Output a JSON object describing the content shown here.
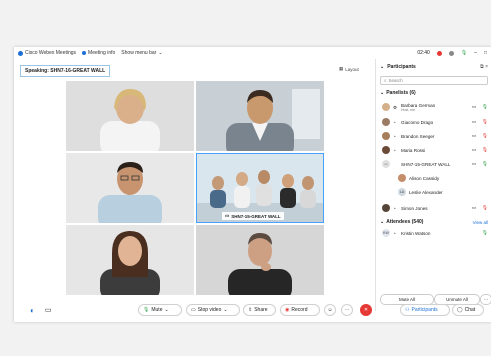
{
  "titlebar": {
    "app": "Cisco Webex Meetings",
    "meeting_info": "Meeting info",
    "menu": "Show menu bar",
    "time": "02:40"
  },
  "speaking": "Speaking: SHN7-16-GREAT WALL",
  "layout_label": "Layout",
  "video_caption": "SHN7-15-GREAT WALL",
  "participants": {
    "title": "Participants",
    "search_placeholder": "Search",
    "panelists_header": "Panelists (6)",
    "panelists": [
      {
        "name": "Barbara German",
        "sub": "Host, me"
      },
      {
        "name": "Giacomo Drago"
      },
      {
        "name": "Brandon Seeger"
      },
      {
        "name": "Maria Rossi"
      },
      {
        "name": "SHN7-15-GREAT WALL"
      },
      {
        "name": "Alison Cassidy"
      },
      {
        "name": "Leslie Alexander"
      },
      {
        "name": "Simon Jones"
      }
    ],
    "attendees_header": "Attendees (540)",
    "view_all": "View all",
    "attendee_initials": "KW",
    "attendee": "Kristin Watson",
    "mute_all": "Mute All",
    "unmute_all": "Unmute All"
  },
  "toolbar": {
    "mute": "Mute",
    "stop_video": "Stop video",
    "share": "Share",
    "record": "Record",
    "participants": "Participants",
    "chat": "Chat"
  },
  "colors": {
    "accent": "#1d6fd6",
    "end_call": "#e53935",
    "selected": "#48a0ff"
  }
}
